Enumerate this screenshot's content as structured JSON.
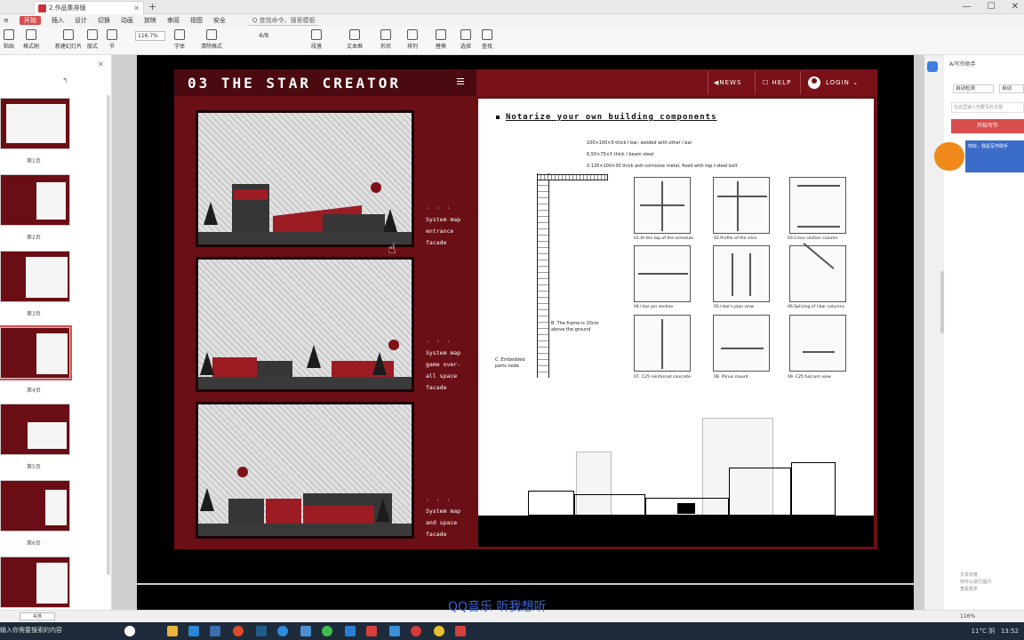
{
  "window": {
    "doc_tab_label": "2.作品集排版",
    "new_tab": "+",
    "controls": [
      "—",
      "☐",
      "✕"
    ]
  },
  "menubar": {
    "items": [
      "≡",
      "开始",
      "插入",
      "设计",
      "切换",
      "动画",
      "放映",
      "审阅",
      "视图",
      "安全"
    ],
    "search_placeholder": "Q 查找命令、搜索模板"
  },
  "toolbar": {
    "buttons": [
      "粘贴",
      "格式刷",
      "新建幻灯片",
      "版式",
      "节",
      "重置",
      "字体",
      "清除格式",
      "段落",
      "文本框",
      "形状",
      "排列",
      "替换",
      "选择",
      "查找"
    ],
    "zoom_value": "116.7%",
    "page_indicator": "4/8"
  },
  "thumbnails": {
    "labels": [
      "第1页",
      "第2页",
      "第3页",
      "第4页",
      "第5页",
      "第6页"
    ]
  },
  "slide": {
    "brand": "03 THE STAR CREATOR",
    "nav": {
      "news": "◀NEWS",
      "help": "☐ HELP",
      "login": "LOGIN ⌄"
    },
    "captions": [
      {
        "dots": "· · ·",
        "lines": [
          "System map",
          "entrance",
          "facade"
        ]
      },
      {
        "dots": "· · ·",
        "lines": [
          "System map",
          "game over-",
          "all space",
          "facade"
        ]
      },
      {
        "dots": "· · ·",
        "lines": [
          "System map",
          "and space",
          "facade"
        ]
      }
    ],
    "sheet": {
      "title": "Notarize your own building components",
      "specs": [
        "100×100×5 thick I bar, welded with other I bar",
        "6.50×75×5 thick I beam steel",
        "0.120×100×30 thick anti-corrosive metal, fixed with top I-steel bolt"
      ],
      "details": [
        "01.At the top of the schedule",
        "02.Profile of the slice",
        "03.Cross section column",
        "04.I bar pin section",
        "05.I-bar's plan view",
        "06.Splicing of I-bar columns",
        "07. C25 reinforced concrete",
        "08. Plinus mount",
        "09. C25 fulcrum view"
      ],
      "frame_note": [
        "B. The frame is 20cm",
        "above the ground"
      ],
      "embedded_note": [
        "C. Embedded",
        "parts node"
      ]
    }
  },
  "right_panel": {
    "title": "Ai写作助手",
    "select_a": "自动检测",
    "select_b": "自动",
    "input_placeholder": "在这里输入你要写的主题",
    "button": "开始写作",
    "card_text": "你好，我是写作助手",
    "footer": [
      "文本长度",
      "你可以进行提问",
      "查看更多"
    ]
  },
  "statusbar": {
    "page": "4/8",
    "zoom": "116%"
  },
  "overlay": {
    "music": "QQ音乐 听我想听"
  },
  "taskbar": {
    "left_text": "输入你需要搜索的内容",
    "weather": "11°C 阴",
    "time": "13:52"
  },
  "colors": {
    "brand_red": "#6b0f16",
    "nav_dark": "#4a0a10",
    "accent": "#d94e4e"
  }
}
